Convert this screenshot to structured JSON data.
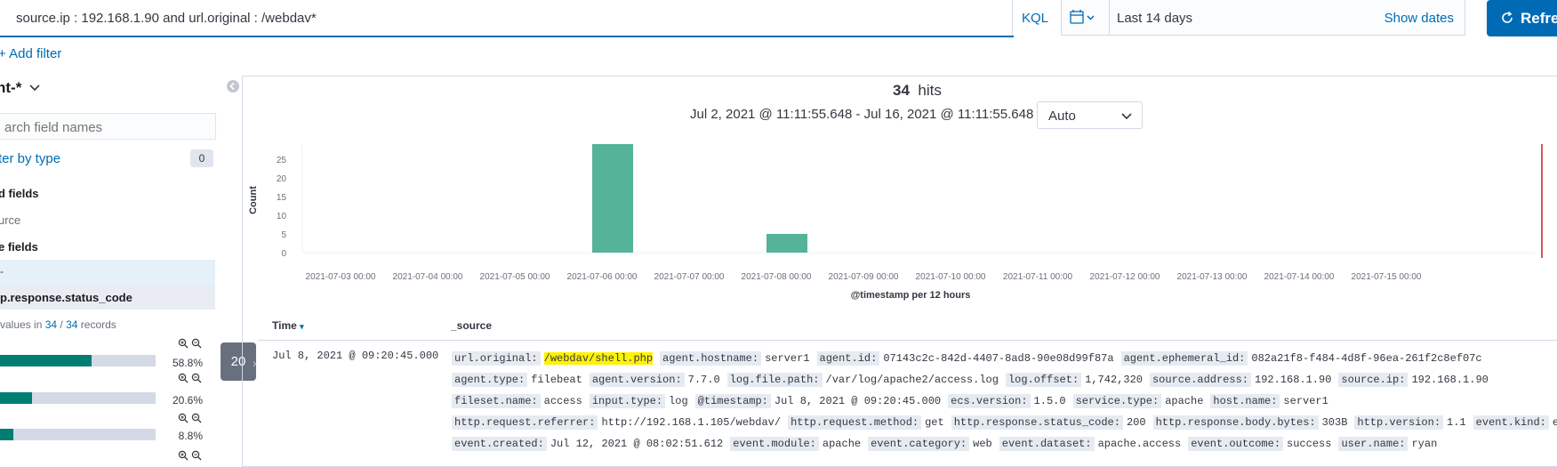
{
  "query": {
    "text": "source.ip : 192.168.1.90 and url.original : /webdav*",
    "language": "KQL"
  },
  "date_picker": {
    "range": "Last 14 days",
    "show_dates": "Show dates"
  },
  "refresh_label": "Refre",
  "add_filter": "+ Add filter",
  "sidebar": {
    "index_pattern": "nt-*",
    "search_placeholder": "arch field names",
    "filter_by_type": "ter by type",
    "filter_count": "0",
    "selected_fields_header": "d fields",
    "selected_field": "urce",
    "available_fields_header": "e fields",
    "available_marker": "-",
    "field_name": "p.response.status_code",
    "top_values": {
      "prefix": "values in ",
      "count": "34",
      "sep": " / ",
      "total": "34",
      "suffix": " records"
    },
    "values": [
      {
        "fraction": 0.588,
        "label": "58.8%"
      },
      {
        "fraction": 0.206,
        "label": "20.6%"
      },
      {
        "fraction": 0.088,
        "label": "8.8%"
      }
    ],
    "tooltip": "20"
  },
  "main": {
    "hits_count": "34",
    "hits_label": "hits",
    "date_range": "Jul 2, 2021 @ 11:11:55.648 - Jul 16, 2021 @ 11:11:55.648 —",
    "interval": "Auto"
  },
  "chart_data": {
    "type": "bar",
    "xlabel": "@timestamp per 12 hours",
    "ylabel": "Count",
    "ylim": [
      0,
      29
    ],
    "yticks": [
      0,
      5,
      10,
      15,
      20,
      25
    ],
    "x_ticks": [
      "2021-07-03 00:00",
      "2021-07-04 00:00",
      "2021-07-05 00:00",
      "2021-07-06 00:00",
      "2021-07-07 00:00",
      "2021-07-08 00:00",
      "2021-07-09 00:00",
      "2021-07-10 00:00",
      "2021-07-11 00:00",
      "2021-07-12 00:00",
      "2021-07-13 00:00",
      "2021-07-14 00:00",
      "2021-07-15 00:00"
    ],
    "bars": [
      {
        "x": "2021-07-06 00:00",
        "value": 29
      },
      {
        "x": "2021-07-08 00:00",
        "value": 5
      }
    ],
    "bar_color": "#54b399",
    "now_marker_color": "#bd271e",
    "grid": false
  },
  "table": {
    "headers": {
      "time": "Time",
      "source": "_source"
    },
    "row": {
      "time": "Jul 8, 2021 @ 09:20:45.000",
      "lines": [
        [
          {
            "k": "url.original:",
            "v": "/webdav/shell.php",
            "hl": true
          },
          {
            "k": "agent.hostname:",
            "v": "server1"
          },
          {
            "k": "agent.id:",
            "v": "07143c2c-842d-4407-8ad8-90e08d99f87a"
          },
          {
            "k": "agent.ephemeral_id:",
            "v": "082a21f8-f484-4d8f-96ea-261f2c8ef07c"
          }
        ],
        [
          {
            "k": "agent.type:",
            "v": "filebeat"
          },
          {
            "k": "agent.version:",
            "v": "7.7.0"
          },
          {
            "k": "log.file.path:",
            "v": "/var/log/apache2/access.log"
          },
          {
            "k": "log.offset:",
            "v": "1,742,320"
          },
          {
            "k": "source.address:",
            "v": "192.168.1.90"
          },
          {
            "k": "source.ip:",
            "v": "192.168.1.90"
          }
        ],
        [
          {
            "k": "fileset.name:",
            "v": "access"
          },
          {
            "k": "input.type:",
            "v": "log"
          },
          {
            "k": "@timestamp:",
            "v": "Jul 8, 2021 @ 09:20:45.000"
          },
          {
            "k": "ecs.version:",
            "v": "1.5.0"
          },
          {
            "k": "service.type:",
            "v": "apache"
          },
          {
            "k": "host.name:",
            "v": "server1"
          }
        ],
        [
          {
            "k": "http.request.referrer:",
            "v": "http://192.168.1.105/webdav/"
          },
          {
            "k": "http.request.method:",
            "v": "get"
          },
          {
            "k": "http.response.status_code:",
            "v": "200"
          },
          {
            "k": "http.response.body.bytes:",
            "v": "303B"
          },
          {
            "k": "http.version:",
            "v": "1.1"
          },
          {
            "k": "event.kind:",
            "v": "e"
          }
        ],
        [
          {
            "k": "event.created:",
            "v": "Jul 12, 2021 @ 08:02:51.612"
          },
          {
            "k": "event.module:",
            "v": "apache"
          },
          {
            "k": "event.category:",
            "v": "web"
          },
          {
            "k": "event.dataset:",
            "v": "apache.access"
          },
          {
            "k": "event.outcome:",
            "v": "success"
          },
          {
            "k": "user.name:",
            "v": "ryan"
          }
        ]
      ]
    }
  }
}
